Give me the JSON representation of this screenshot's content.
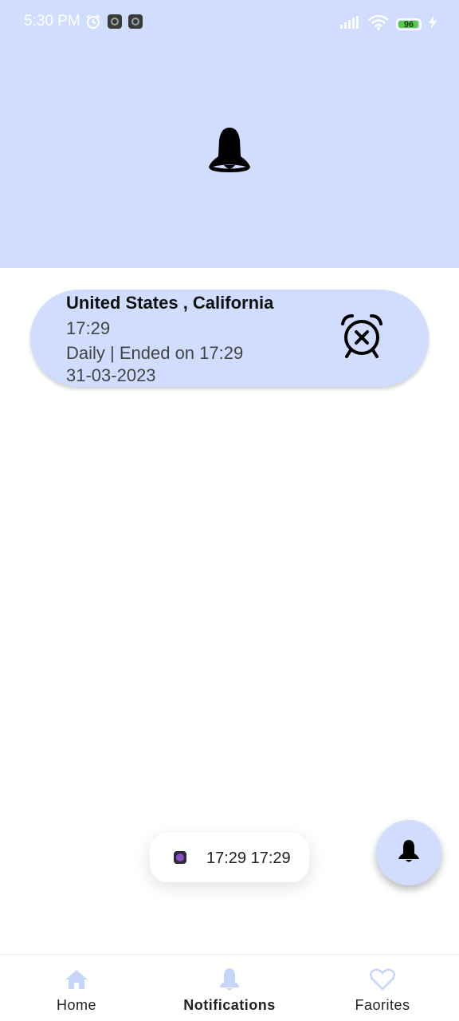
{
  "status_bar": {
    "time": "5:30 PM",
    "battery_level": "96",
    "battery_fraction": 0.96
  },
  "header": {
    "icon": "bell-icon"
  },
  "notification_card": {
    "title": "United States , California",
    "time": "17:29",
    "repeat": "Daily | Ended on 17:29",
    "date": "31-03-2023",
    "action_icon": "alarm-off-icon"
  },
  "toast": {
    "text": "17:29 17:29"
  },
  "fab": {
    "icon": "bell-icon"
  },
  "bottom_nav": {
    "items": [
      {
        "label": "Home",
        "icon": "home-icon",
        "active": false
      },
      {
        "label": "Notifications",
        "icon": "bell-icon",
        "active": true
      },
      {
        "label": "Faorites",
        "icon": "heart-icon",
        "active": false
      }
    ]
  },
  "colors": {
    "accent": "#d0ddfe",
    "icon_dark": "#000000",
    "nav_icon": "#c6d6fb"
  }
}
